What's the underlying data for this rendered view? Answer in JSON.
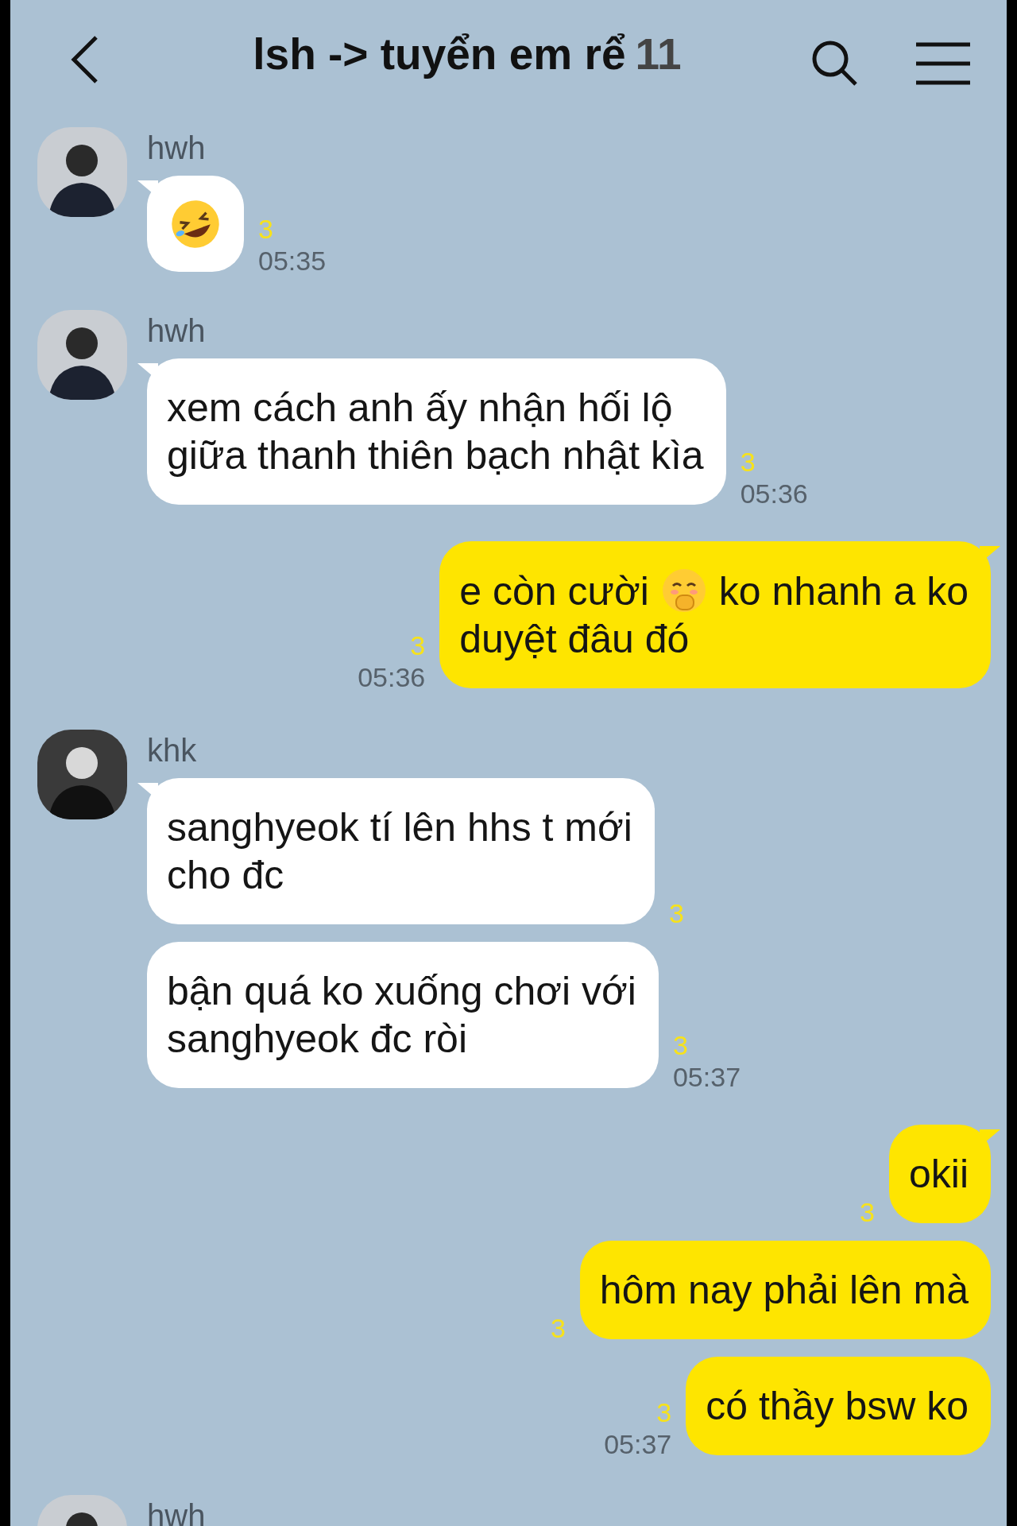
{
  "header": {
    "title": "lsh -> tuyển em rể",
    "member_count": "11"
  },
  "groups": [
    {
      "kind": "incoming",
      "sender": "hwh",
      "bubbles": [
        {
          "segments": [
            {
              "kind": "emoji"
            }
          ],
          "unread": "3",
          "time": "05:35"
        }
      ]
    },
    {
      "kind": "incoming",
      "sender": "hwh",
      "bubbles": [
        {
          "segments": [
            {
              "kind": "text",
              "text": "xem cách anh ấy nhận hối lộ\ngiữa thanh thiên bạch nhật kìa"
            }
          ],
          "unread": "3",
          "time": "05:36"
        }
      ]
    },
    {
      "kind": "outgoing",
      "bubbles": [
        {
          "segments": [
            {
              "kind": "text",
              "text": "e còn cười"
            },
            {
              "kind": "emoji"
            },
            {
              "kind": "text",
              "text": "ko nhanh a ko"
            },
            {
              "kind": "line_break"
            },
            {
              "kind": "text",
              "text": "duyệt đâu đó"
            }
          ],
          "unread": "3",
          "time": "05:36"
        }
      ]
    },
    {
      "kind": "incoming",
      "sender": "khk",
      "bubbles": [
        {
          "segments": [
            {
              "kind": "text",
              "text": "sanghyeok tí lên hhs t mới\ncho đc"
            }
          ],
          "unread": "3"
        },
        {
          "segments": [
            {
              "kind": "text",
              "text": "bận quá ko xuống chơi với\nsanghyeok đc ròi"
            }
          ],
          "unread": "3",
          "time": "05:37"
        }
      ]
    },
    {
      "kind": "outgoing",
      "bubbles": [
        {
          "segments": [
            {
              "kind": "text",
              "text": "okii"
            }
          ],
          "unread": "3"
        },
        {
          "segments": [
            {
              "kind": "text",
              "text": "hôm nay phải lên mà"
            }
          ],
          "unread": "3"
        },
        {
          "segments": [
            {
              "kind": "text",
              "text": "có thầy bsw ko"
            }
          ],
          "unread": "3",
          "time": "05:37"
        }
      ]
    },
    {
      "kind": "incoming",
      "sender": "hwh"
    }
  ]
}
